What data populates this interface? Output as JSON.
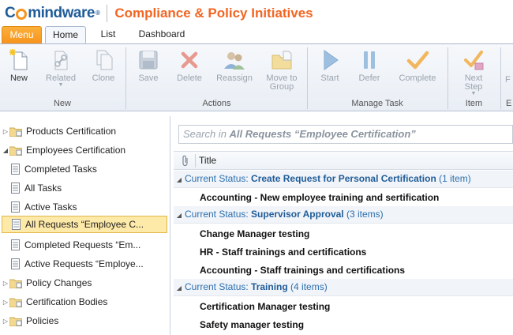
{
  "header": {
    "logo": {
      "pre": "C",
      "post": "mindware",
      "reg": "®"
    },
    "app_title": "Compliance & Policy Initiatives"
  },
  "tabs": [
    {
      "label": "Menu"
    },
    {
      "label": "Home"
    },
    {
      "label": "List"
    },
    {
      "label": "Dashboard"
    }
  ],
  "ribbon": {
    "buttons": {
      "new": "New",
      "related": "Related",
      "clone": "Clone",
      "save": "Save",
      "delete": "Delete",
      "reassign": "Reassign",
      "move_l1": "Move to",
      "move_l2": "Group",
      "start": "Start",
      "defer": "Defer",
      "complete": "Complete",
      "next_l1": "Next",
      "next_l2": "Step"
    },
    "groups": {
      "new": "New",
      "actions": "Actions",
      "manage_task": "Manage Task",
      "item": "Item",
      "cut_e": "E"
    },
    "cut_button": "F"
  },
  "tree": {
    "items": [
      {
        "label": "Products Certification",
        "kind": "folder"
      },
      {
        "label": "Employees Certification",
        "kind": "folder"
      },
      {
        "label": "Completed Tasks",
        "kind": "list"
      },
      {
        "label": "All Tasks",
        "kind": "list"
      },
      {
        "label": "Active Tasks",
        "kind": "list"
      },
      {
        "label": "All Requests “Employee C...",
        "kind": "list"
      },
      {
        "label": "Completed Requests “Em...",
        "kind": "list"
      },
      {
        "label": "Active Requests “Employe...",
        "kind": "list"
      },
      {
        "label": "Policy Changes",
        "kind": "folder"
      },
      {
        "label": "Certification Bodies",
        "kind": "folder"
      },
      {
        "label": "Policies",
        "kind": "folder"
      }
    ]
  },
  "main": {
    "search": {
      "prefix": "Search in ",
      "scope": "All Requests “Employee Certification”"
    },
    "column_title": "Title",
    "groups": [
      {
        "label": "Current Status: ",
        "value": "Create Request for Personal Certification",
        "count": " (1 item)",
        "rows": [
          "Accounting - New employee training and sertification"
        ]
      },
      {
        "label": "Current Status: ",
        "value": "Supervisor Approval",
        "count": " (3 items)",
        "rows": [
          "Change Manager testing",
          "HR - Staff trainings and certifications",
          "Accounting - Staff trainings and certifications"
        ]
      },
      {
        "label": "Current Status: ",
        "value": "Training",
        "count": " (4 items)",
        "rows": [
          "Certification Manager testing",
          "Safety manager testing"
        ]
      }
    ]
  },
  "colors": {
    "brand_blue": "#1f5c99",
    "accent_orange": "#f26522",
    "menu_orange": "#f7941d",
    "selection": "#fde9a8"
  }
}
